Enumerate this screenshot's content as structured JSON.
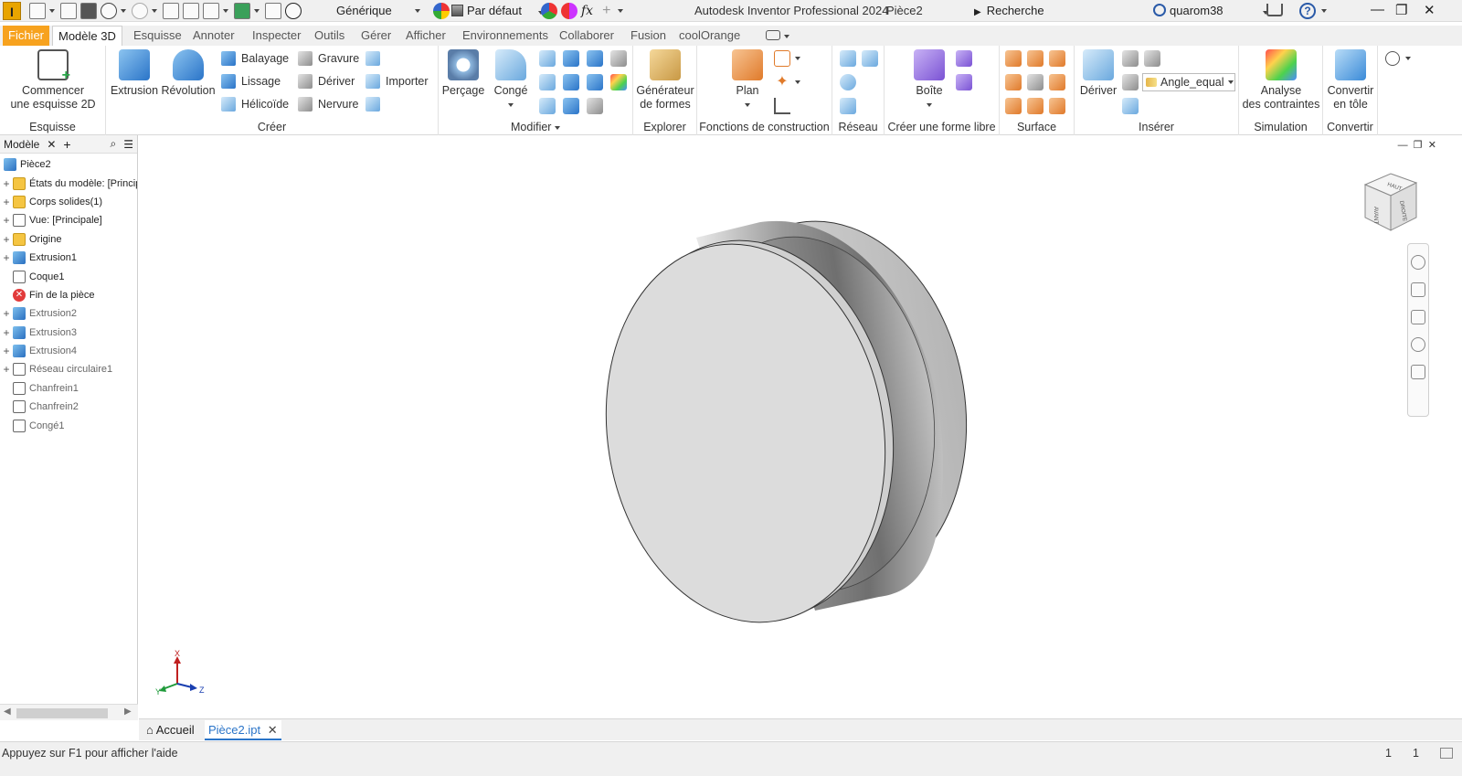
{
  "titlebar": {
    "app_logo": "I",
    "material": "Générique",
    "appearance": "Par défaut",
    "fx": "fx",
    "app_title": "Autodesk Inventor Professional 2024",
    "document": "Pièce2",
    "search_placeholder": "Recherche (aide/commandes)...",
    "user": "quarom38",
    "help": "?",
    "minimize": "—",
    "restore": "❐",
    "close": "✕"
  },
  "tabs": [
    "Fichier",
    "Modèle 3D",
    "Esquisse",
    "Annoter",
    "Inspecter",
    "Outils",
    "Gérer",
    "Afficher",
    "Environnements",
    "Collaborer",
    "Fusion",
    "coolOrange"
  ],
  "active_tab": "Modèle 3D",
  "ribbon": {
    "esquisse": {
      "title": "Esquisse",
      "start_sketch": "Commencer",
      "start_sketch_2": "une esquisse 2D"
    },
    "creer": {
      "title": "Créer",
      "extrusion": "Extrusion",
      "revolution": "Révolution",
      "balayage": "Balayage",
      "lissage": "Lissage",
      "helicoide": "Hélicoïde",
      "gravure": "Gravure",
      "deriver": "Dériver",
      "nervure": "Nervure",
      "importer": "Importer"
    },
    "modifier": {
      "title": "Modifier",
      "percage": "Perçage",
      "conge": "Congé"
    },
    "explorer": {
      "title": "Explorer",
      "generateur": "Générateur",
      "generateur_2": "de formes"
    },
    "fonctions": {
      "title": "Fonctions de construction",
      "plan": "Plan"
    },
    "reseau": {
      "title": "Réseau"
    },
    "forme_libre": {
      "title": "Créer une forme libre",
      "boite": "Boîte"
    },
    "surface": {
      "title": "Surface"
    },
    "inserer": {
      "title": "Insérer",
      "deriver": "Dériver",
      "param": "Angle_equal"
    },
    "simulation": {
      "title": "Simulation",
      "analyse": "Analyse",
      "analyse_2": "des contraintes"
    },
    "convertir": {
      "title": "Convertir",
      "tole": "Convertir",
      "tole_2": "en tôle"
    }
  },
  "browser": {
    "tab_label": "Modèle",
    "add": "+",
    "nodes": [
      {
        "label": "Pièce2",
        "icon": "part-icon",
        "expand": "",
        "dim": false
      },
      {
        "label": "États du modèle: [Principale]",
        "icon": "folder-icon",
        "expand": "+",
        "dim": false
      },
      {
        "label": "Corps solides(1)",
        "icon": "folder-icon",
        "expand": "+",
        "dim": false
      },
      {
        "label": "Vue: [Principale]",
        "icon": "view-icon",
        "expand": "+",
        "dim": false
      },
      {
        "label": "Origine",
        "icon": "folder-icon",
        "expand": "+",
        "dim": false
      },
      {
        "label": "Extrusion1",
        "icon": "extrusion-icon",
        "expand": "+",
        "dim": false
      },
      {
        "label": "Coque1",
        "icon": "shell-icon",
        "expand": "",
        "dim": false
      },
      {
        "label": "Fin de la pièce",
        "icon": "end-of-part-icon",
        "expand": "",
        "dim": false
      },
      {
        "label": "Extrusion2",
        "icon": "extrusion-icon",
        "expand": "+",
        "dim": true
      },
      {
        "label": "Extrusion3",
        "icon": "extrusion-icon",
        "expand": "+",
        "dim": true
      },
      {
        "label": "Extrusion4",
        "icon": "extrusion-icon",
        "expand": "+",
        "dim": true
      },
      {
        "label": "Réseau circulaire1",
        "icon": "circular-pattern-icon",
        "expand": "+",
        "dim": true
      },
      {
        "label": "Chanfrein1",
        "icon": "chamfer-icon",
        "expand": "",
        "dim": true
      },
      {
        "label": "Chanfrein2",
        "icon": "chamfer-icon",
        "expand": "",
        "dim": true
      },
      {
        "label": "Congé1",
        "icon": "fillet-icon",
        "expand": "",
        "dim": true
      }
    ]
  },
  "viewcube": {
    "front": "DROITE",
    "left": "AVANT",
    "top": "HAUT"
  },
  "triad": {
    "x": "X",
    "y": "Y",
    "z": "Z"
  },
  "doc_tabs": {
    "home": "Accueil",
    "active": "Pièce2.ipt"
  },
  "status": {
    "help_text": "Appuyez sur F1 pour afficher l'aide",
    "count_a": "1",
    "count_b": "1"
  },
  "colors": {
    "accent": "#2a74c8",
    "file_tab": "#f7a21e"
  }
}
